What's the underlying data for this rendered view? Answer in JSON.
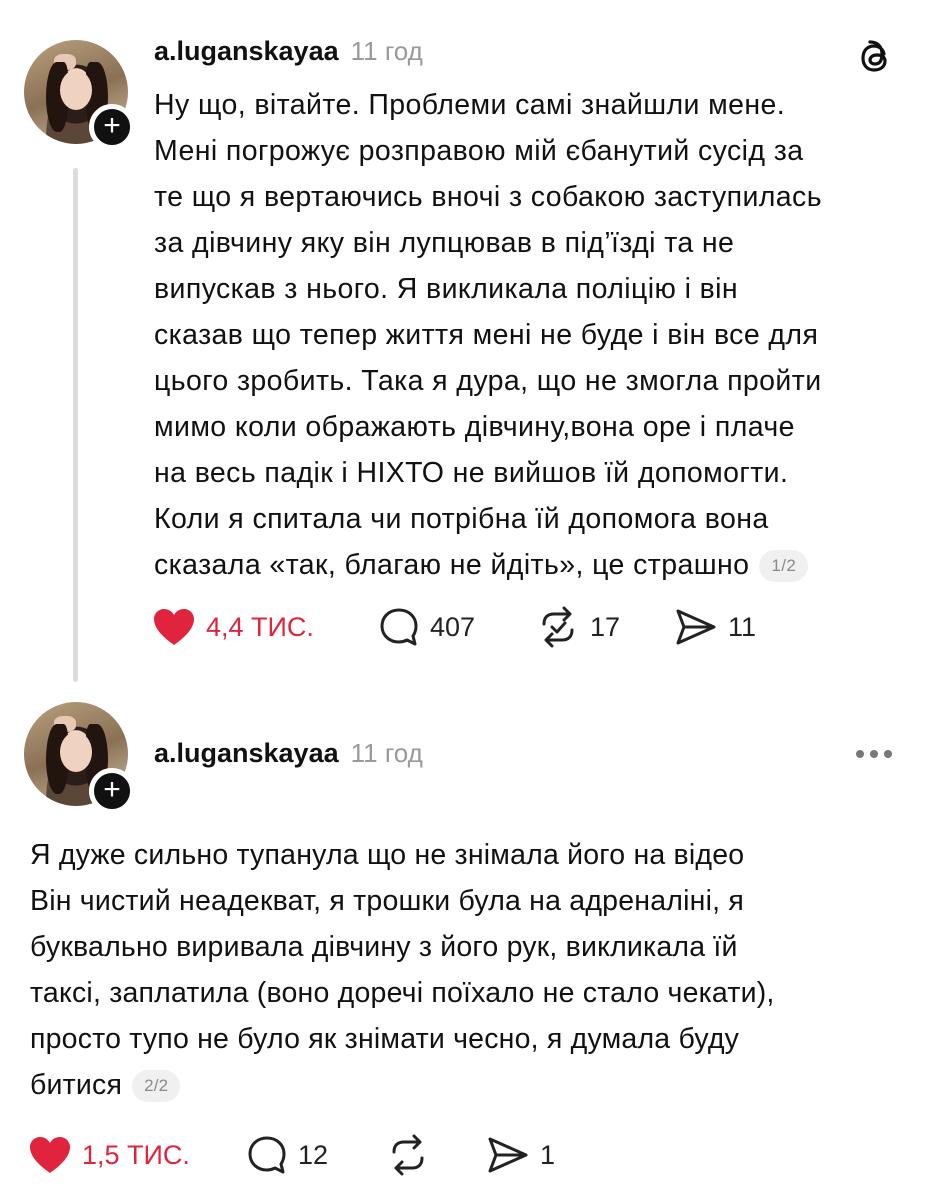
{
  "post1": {
    "username": "a.luganskayaa",
    "time": "11 год",
    "lines": [
      "Ну що, вітайте. Проблеми самі знайшли мене.",
      "Мені погрожує розправою мій єбанутий сусід за",
      "те що я вертаючись вночі з собакою заступилась",
      "за дівчину яку він лупцював в під’їзді та не",
      "випускав з нього. Я викликала поліцію і він",
      "сказав що тепер життя мені не буде і він все для",
      "цього зробить. Така я дура, що не змогла пройти",
      "мимо коли ображають дівчину,вона оре і плаче",
      "на весь падік і НІХТО не вийшов їй допомогти.",
      "Коли я спитала чи потрібна їй допомога вона",
      "сказала «так, благаю не йдіть», це страшно"
    ],
    "page_badge": "1/2",
    "likes": "4,4 ТИС.",
    "comments": "407",
    "reposts": "17",
    "shares": "11"
  },
  "post2": {
    "username": "a.luganskayaa",
    "time": "11 год",
    "lines": [
      "Я дуже сильно тупанула що не знімала його на відео",
      "Він чистий неадекват, я трошки була на адреналіні, я",
      "буквально виривала дівчину з його рук, викликала їй",
      "таксі, заплатила (воно доречі поїхало не стало чекати),",
      "просто тупо не було як знімати чесно, я думала буду",
      "битися"
    ],
    "page_badge": "2/2",
    "likes": "1,5 ТИС.",
    "comments": "12",
    "reposts": "",
    "shares": "1"
  },
  "colors": {
    "like_red": "#e0243d",
    "text": "#111111",
    "muted": "#9a9a9a"
  },
  "icons": [
    "threads-logo-icon",
    "plus-icon",
    "heart-icon",
    "comment-icon",
    "repost-icon",
    "share-icon",
    "more-icon"
  ]
}
